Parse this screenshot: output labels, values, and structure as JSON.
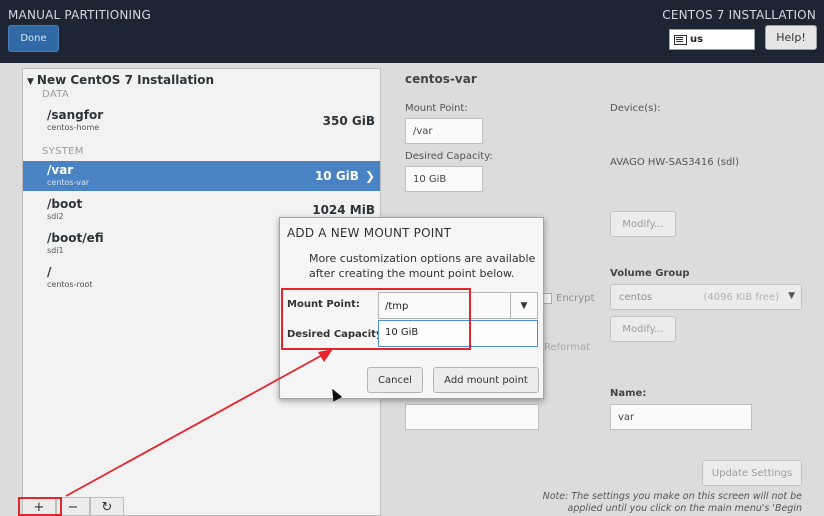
{
  "header": {
    "title": "MANUAL PARTITIONING",
    "done_label": "Done",
    "product": "CENTOS 7 INSTALLATION",
    "keyboard_layout": "us",
    "help_label": "Help!"
  },
  "tree": {
    "group_label": "New CentOS 7 Installation",
    "sections": [
      {
        "label": "DATA"
      },
      {
        "label": "SYSTEM"
      }
    ],
    "entries": [
      {
        "mount": "/sangfor",
        "device": "centos-home",
        "size": "350 GiB"
      },
      {
        "mount": "/var",
        "device": "centos-var",
        "size": "10 GiB",
        "selected": true
      },
      {
        "mount": "/boot",
        "device": "sdi2",
        "size": "1024 MiB"
      },
      {
        "mount": "/boot/efi",
        "device": "sdi1",
        "size": ""
      },
      {
        "mount": "/",
        "device": "centos-root",
        "size": ""
      }
    ],
    "toolbar": {
      "add": "+",
      "remove": "−",
      "refresh": "↻"
    }
  },
  "detail": {
    "title": "centos-var",
    "mount_point_label": "Mount Point:",
    "mount_point_value": "/var",
    "desired_capacity_label": "Desired Capacity:",
    "desired_capacity_value": "10 GiB",
    "devices_label": "Device(s):",
    "device_value": "AVAGO HW-SAS3416 (sdl)",
    "modify_label": "Modify...",
    "encrypt_label": "Encrypt",
    "reformat_label": "Reformat",
    "volume_group_label": "Volume Group",
    "volume_group_name": "centos",
    "volume_group_free": "(4096 KiB free)",
    "modify2_label": "Modify...",
    "name_label": "Name:",
    "name_value": "var",
    "update_label": "Update Settings",
    "note": "Note:  The settings you make on this screen will not be applied until you click on the main menu's 'Begin"
  },
  "dialog": {
    "title": "ADD A NEW MOUNT POINT",
    "text_line1": "More customization options are available",
    "text_line2": "after creating the mount point below.",
    "mount_point_label": "Mount Point:",
    "mount_point_value": "/tmp",
    "capacity_label": "Desired Capacity:",
    "capacity_value": "10 GiB",
    "cancel_label": "Cancel",
    "add_label": "Add mount point"
  },
  "colors": {
    "header_bg": "#1d2432",
    "selection": "#4a83c3",
    "annotation_red": "#e3262c"
  }
}
